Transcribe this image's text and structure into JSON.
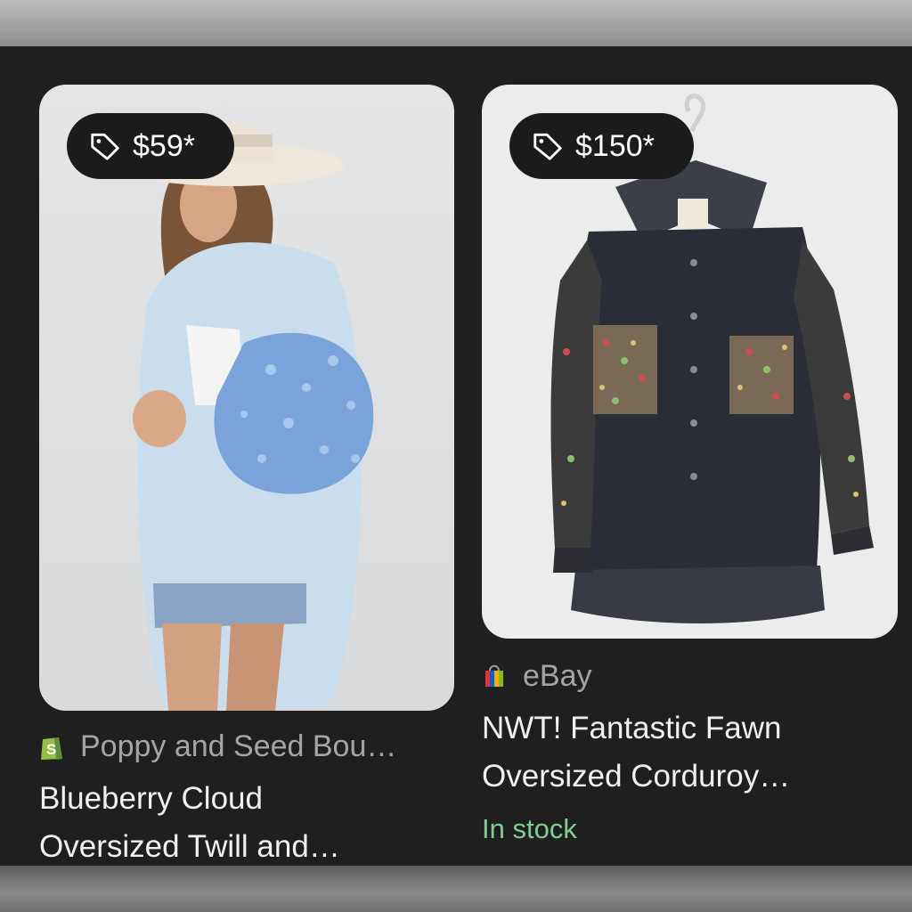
{
  "results": [
    {
      "price": "$59*",
      "image_alt": "Woman in white hat wearing light blue oversized shirt with blue sequin sleeves",
      "source_icon": "shopify-bag-icon",
      "source": "Poppy and Seed Bou…",
      "title_line1": "Blueberry Cloud",
      "title_line2": "Oversized Twill and…"
    },
    {
      "price": "$150*",
      "image_alt": "Dark corduroy oversized shirt with multicolor sequin sleeves and pockets on a hanger",
      "source_icon": "ebay-bag-icon",
      "source": "eBay",
      "title_line1": "NWT! Fantastic Fawn",
      "title_line2": "Oversized Corduroy…",
      "availability": "In stock"
    }
  ]
}
